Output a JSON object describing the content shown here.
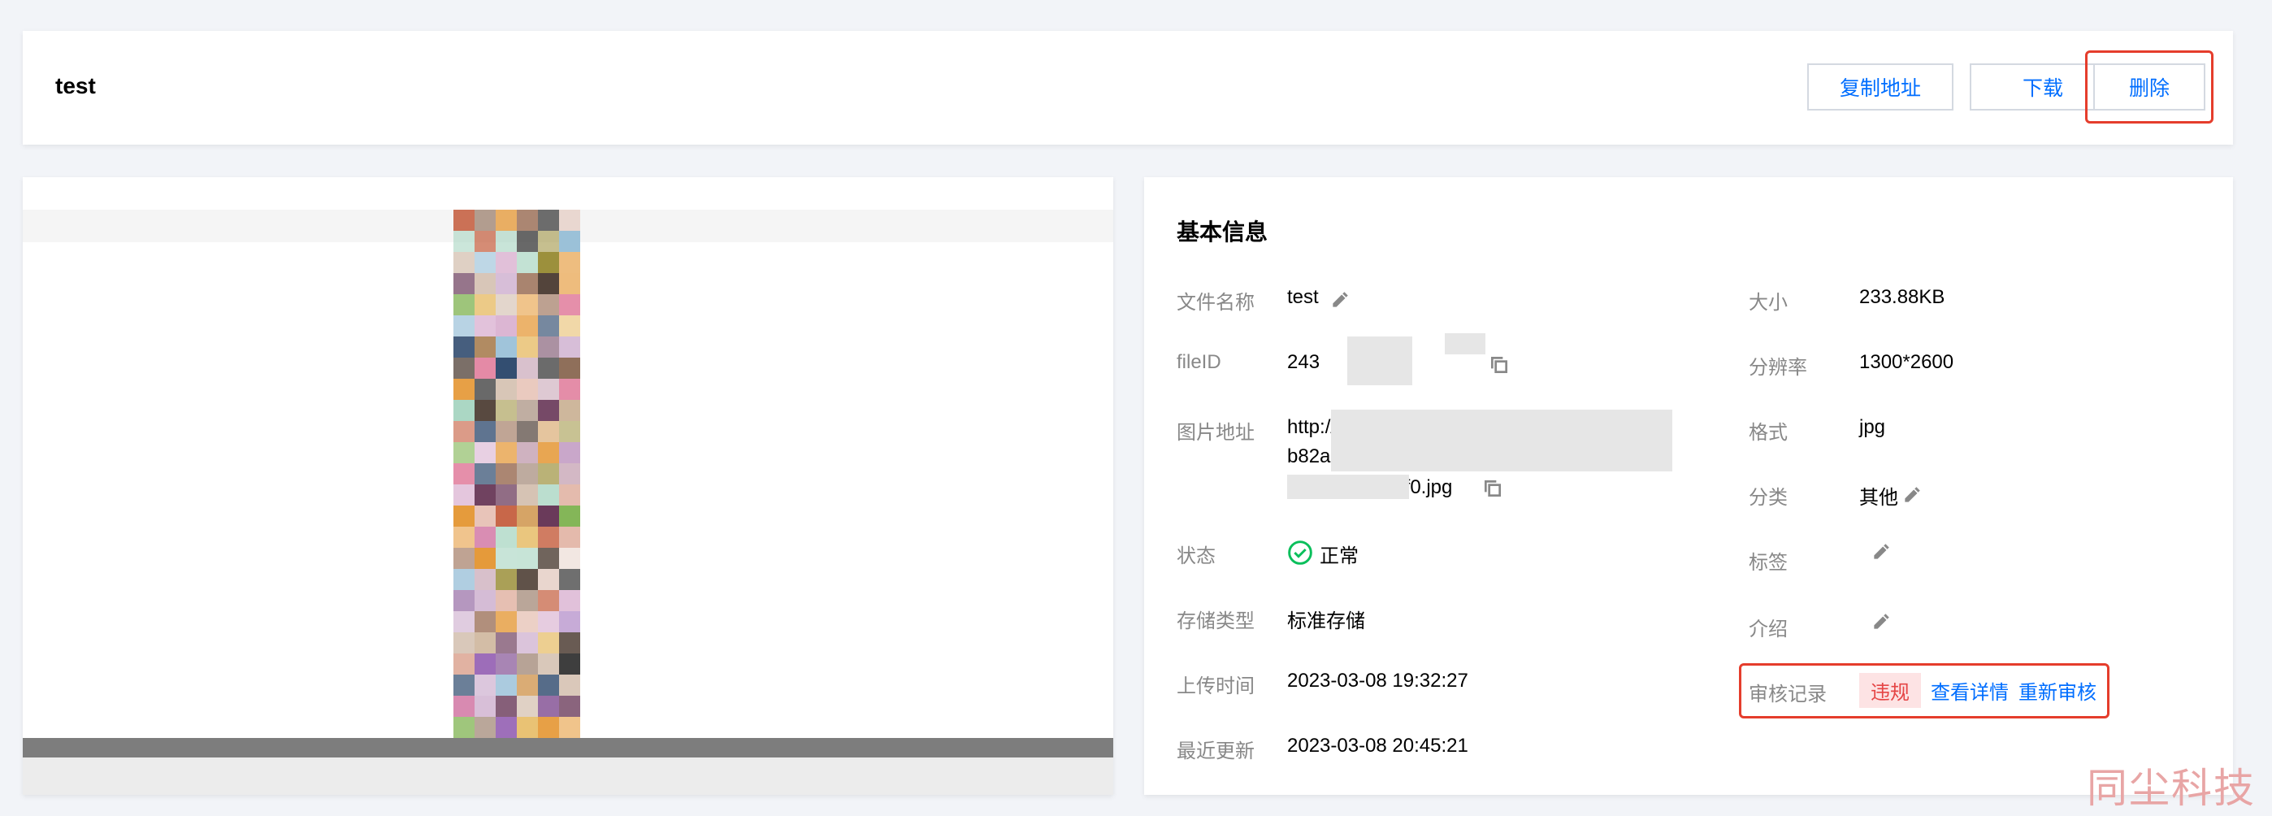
{
  "header": {
    "title": "test",
    "buttons": {
      "copy": "复制地址",
      "download": "下载",
      "delete": "删除"
    }
  },
  "info": {
    "title": "基本信息",
    "file_name": {
      "label": "文件名称",
      "value": "test"
    },
    "file_id": {
      "label": "fileID",
      "value": "243"
    },
    "image_url": {
      "label": "图片地址",
      "line1": "http://1",
      "line2": "b82a1v",
      "line3": "/f0.jpg"
    },
    "status": {
      "label": "状态",
      "value": "正常"
    },
    "storage_type": {
      "label": "存储类型",
      "value": "标准存储"
    },
    "upload_time": {
      "label": "上传时间",
      "value": "2023-03-08 19:32:27"
    },
    "last_update": {
      "label": "最近更新",
      "value": "2023-03-08 20:45:21"
    },
    "size": {
      "label": "大小",
      "value": "233.88KB"
    },
    "resolution": {
      "label": "分辨率",
      "value": "1300*2600"
    },
    "format": {
      "label": "格式",
      "value": "jpg"
    },
    "category": {
      "label": "分类",
      "value": "其他"
    },
    "tags": {
      "label": "标签"
    },
    "intro": {
      "label": "介绍"
    },
    "audit": {
      "label": "审核记录",
      "badge": "违规",
      "view_details": "查看详情",
      "re_audit": "重新审核"
    }
  },
  "watermark": "同尘科技",
  "colors": {
    "link": "#006eff",
    "highlight": "#e53d2c",
    "success": "#0abf5b",
    "violation_bg": "#fde3e4",
    "violation_text": "#e54545"
  }
}
